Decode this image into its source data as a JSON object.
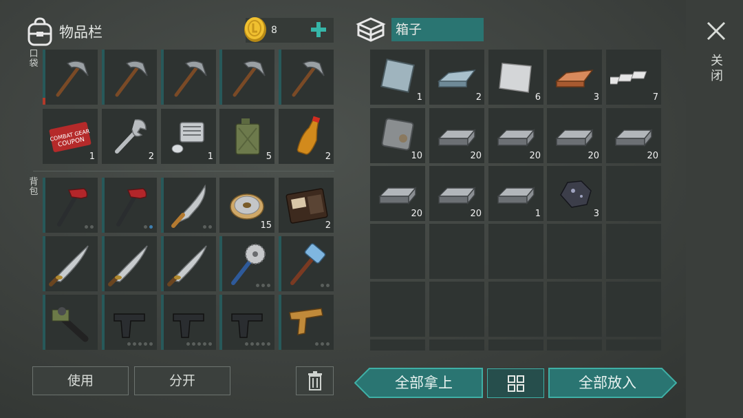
{
  "inventory": {
    "title": "物品栏",
    "coins": "8"
  },
  "labels": {
    "pocket": "口袋",
    "backpack": "背包",
    "close": "关闭"
  },
  "container": {
    "title": "箱子"
  },
  "buttons": {
    "use": "使用",
    "split": "分开",
    "take_all": "全部拿上",
    "put_all": "全部放入"
  },
  "pocket": [
    {
      "icon": "pickaxe-icon",
      "qty": ""
    },
    {
      "icon": "pickaxe-icon",
      "qty": ""
    },
    {
      "icon": "pickaxe-icon",
      "qty": ""
    },
    {
      "icon": "pickaxe-icon",
      "qty": ""
    },
    {
      "icon": "pickaxe-icon",
      "qty": ""
    },
    {
      "icon": "coupon-icon",
      "qty": "1"
    },
    {
      "icon": "wrench-icon",
      "qty": "2"
    },
    {
      "icon": "engine-part-icon",
      "qty": "1"
    },
    {
      "icon": "jerrycan-icon",
      "qty": "5"
    },
    {
      "icon": "bottle-icon",
      "qty": "2"
    }
  ],
  "backpack": [
    {
      "icon": "hammer-icon",
      "qty": ""
    },
    {
      "icon": "hammer-icon",
      "qty": ""
    },
    {
      "icon": "machete-icon",
      "qty": ""
    },
    {
      "icon": "wire-spool-icon",
      "qty": "15"
    },
    {
      "icon": "wallet-icon",
      "qty": "2"
    },
    {
      "icon": "katana-icon",
      "qty": ""
    },
    {
      "icon": "katana-icon",
      "qty": ""
    },
    {
      "icon": "katana-icon",
      "qty": ""
    },
    {
      "icon": "saw-mace-icon",
      "qty": ""
    },
    {
      "icon": "sledgehammer-icon",
      "qty": ""
    },
    {
      "icon": "grenade-launcher-icon",
      "qty": ""
    },
    {
      "icon": "pistol-icon",
      "qty": ""
    },
    {
      "icon": "pistol-icon",
      "qty": ""
    },
    {
      "icon": "pistol-icon",
      "qty": ""
    },
    {
      "icon": "flare-gun-icon",
      "qty": ""
    }
  ],
  "box": [
    {
      "icon": "steel-plate-icon",
      "qty": "1"
    },
    {
      "icon": "iron-ingot-icon",
      "qty": "2"
    },
    {
      "icon": "aluminum-sheet-icon",
      "qty": "6"
    },
    {
      "icon": "copper-ingot-icon",
      "qty": "3"
    },
    {
      "icon": "silver-bars-icon",
      "qty": "7"
    },
    {
      "icon": "rusty-plate-icon",
      "qty": "10"
    },
    {
      "icon": "metal-ingot-icon",
      "qty": "20"
    },
    {
      "icon": "metal-ingot-icon",
      "qty": "20"
    },
    {
      "icon": "metal-ingot-icon",
      "qty": "20"
    },
    {
      "icon": "metal-ingot-icon",
      "qty": "20"
    },
    {
      "icon": "metal-ingot-icon",
      "qty": "20"
    },
    {
      "icon": "metal-ingot-icon",
      "qty": "20"
    },
    {
      "icon": "metal-ingot-icon",
      "qty": "1"
    },
    {
      "icon": "ore-icon",
      "qty": "3"
    }
  ],
  "colors": {
    "accent": "#2a8a85",
    "bar": "#27595a",
    "slot": "#2e3331"
  }
}
